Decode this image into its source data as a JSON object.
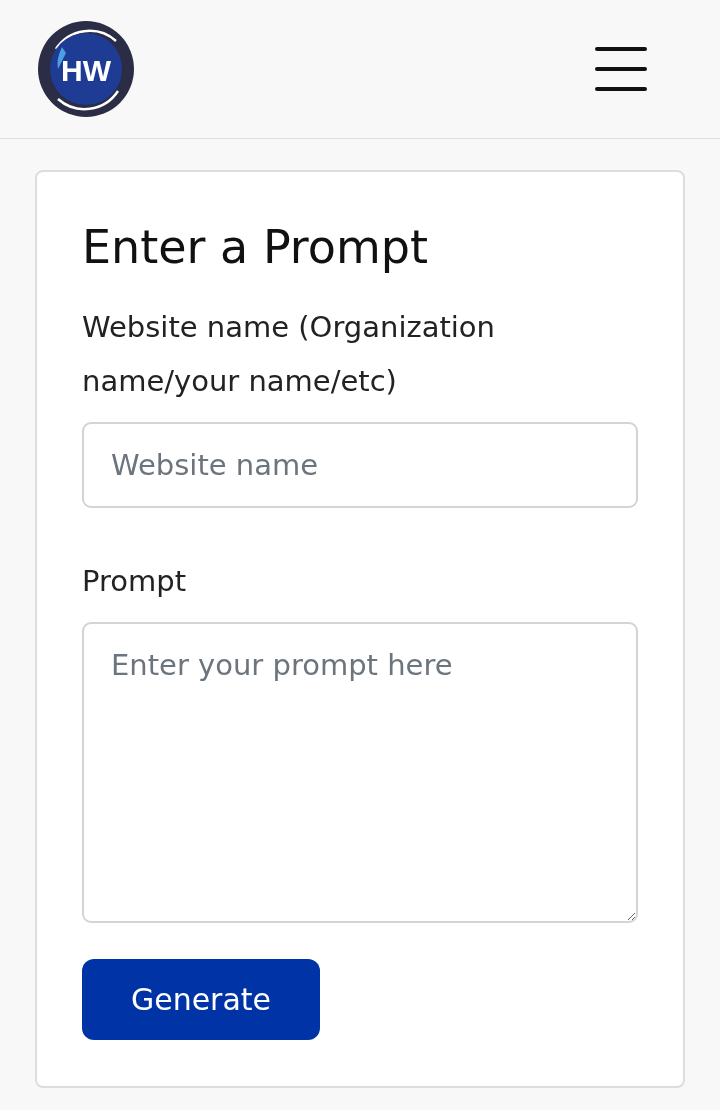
{
  "header": {
    "logo": {
      "text": "HW"
    }
  },
  "form": {
    "title": "Enter a Prompt",
    "fields": [
      {
        "kind": "input",
        "label": "Website name (Organization name/your name/etc)",
        "placeholder": "Website name"
      },
      {
        "kind": "textarea",
        "label": "Prompt",
        "placeholder": "Enter your prompt here"
      }
    ],
    "submit": "Generate"
  }
}
